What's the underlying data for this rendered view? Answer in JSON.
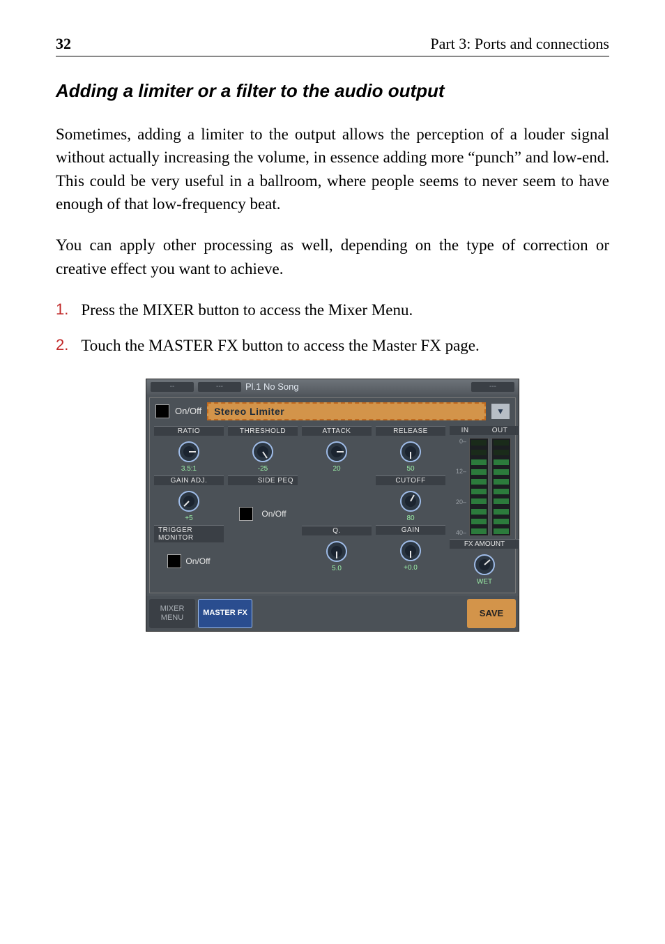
{
  "header": {
    "page_number": "32",
    "part_title": "Part 3: Ports and connections"
  },
  "section_title": "Adding a limiter or a filter to the audio output",
  "paragraphs": {
    "p1": "Sometimes, adding a limiter to the output allows the perception of a louder signal without actually increasing the volume, in essence adding more “punch” and low-end. This could be very useful in a ballroom, where people seems to never seem to have enough of that low-frequency beat.",
    "p2": "You can apply other processing as well, depending on the type of correction or creative effect you want to achieve."
  },
  "steps": {
    "s1_num": "1.",
    "s1_text": "Press the MIXER button to access the Mixer Menu.",
    "s2_num": "2.",
    "s2_text": "Touch the MASTER FX button to access the Master FX page."
  },
  "mixer": {
    "titlebar": {
      "left1": "--",
      "left2": "---",
      "song": "Pl.1  No Song",
      "right": "---"
    },
    "onoff_label": "On/Off",
    "fx_name": "Stereo Limiter",
    "dropdown_glyph": "▼",
    "knobs": {
      "ratio_label": "RATIO",
      "ratio_value": "3.5:1",
      "threshold_label": "THRESHOLD",
      "threshold_value": "-25",
      "attack_label": "ATTACK",
      "attack_value": "20",
      "release_label": "RELEASE",
      "release_value": "50",
      "gainadj_label": "GAIN ADJ.",
      "gainadj_value": "+5",
      "sidepeq_label": "SIDE PEQ",
      "cutoff_label": "CUTOFF",
      "cutoff_value": "80",
      "trigger_label": "TRIGGER MONITOR",
      "q_label": "Q.",
      "q_value": "5.0",
      "gain_label": "GAIN",
      "gain_value": "+0.0",
      "fxamount_label": "FX AMOUNT",
      "fxamount_value": "WET"
    },
    "meter": {
      "in": "IN",
      "out": "OUT",
      "s0": "0–",
      "s12": "12–",
      "s20": "20–",
      "s40": "40–"
    },
    "tabs": {
      "menu": "MIXER MENU",
      "masterfx": "MASTER FX",
      "save": "SAVE"
    }
  }
}
